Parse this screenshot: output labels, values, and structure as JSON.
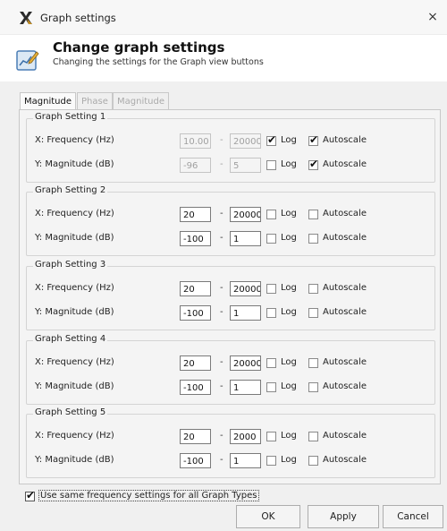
{
  "window": {
    "title": "Graph settings",
    "close_glyph": "×",
    "icon": "x-app-icon"
  },
  "header": {
    "title": "Change graph settings",
    "subtitle": "Changing the settings for the Graph view buttons",
    "icon": "graph-edit-icon"
  },
  "tabs": [
    {
      "label": "Magnitude",
      "active": true
    },
    {
      "label": "Phase",
      "active": false
    },
    {
      "label": "Magnitude / Phase",
      "active": false
    }
  ],
  "labels": {
    "x_row": "X: Frequency (Hz)",
    "y_row": "Y: Magnitude (dB)",
    "dash": "-",
    "log": "Log",
    "autoscale": "Autoscale"
  },
  "groups": [
    {
      "title": "Graph Setting 1",
      "disabled": true,
      "x": {
        "min": "10.00",
        "max": "20000",
        "log": true,
        "autoscale": true
      },
      "y": {
        "min": "-96",
        "max": "5",
        "log": false,
        "autoscale": true
      }
    },
    {
      "title": "Graph Setting 2",
      "disabled": false,
      "x": {
        "min": "20",
        "max": "20000",
        "log": false,
        "autoscale": false
      },
      "y": {
        "min": "-100",
        "max": "1",
        "log": false,
        "autoscale": false
      }
    },
    {
      "title": "Graph Setting 3",
      "disabled": false,
      "x": {
        "min": "20",
        "max": "20000",
        "log": false,
        "autoscale": false
      },
      "y": {
        "min": "-100",
        "max": "1",
        "log": false,
        "autoscale": false
      }
    },
    {
      "title": "Graph Setting 4",
      "disabled": false,
      "x": {
        "min": "20",
        "max": "20000",
        "log": false,
        "autoscale": false
      },
      "y": {
        "min": "-100",
        "max": "1",
        "log": false,
        "autoscale": false
      }
    },
    {
      "title": "Graph Setting 5",
      "disabled": false,
      "x": {
        "min": "20",
        "max": "2000",
        "log": false,
        "autoscale": false
      },
      "y": {
        "min": "-100",
        "max": "1",
        "log": false,
        "autoscale": false
      }
    }
  ],
  "footer": {
    "same_freq_label": "Use same frequency settings for all Graph Types",
    "same_freq_checked": true,
    "ok": "OK",
    "apply": "Apply",
    "cancel": "Cancel"
  }
}
